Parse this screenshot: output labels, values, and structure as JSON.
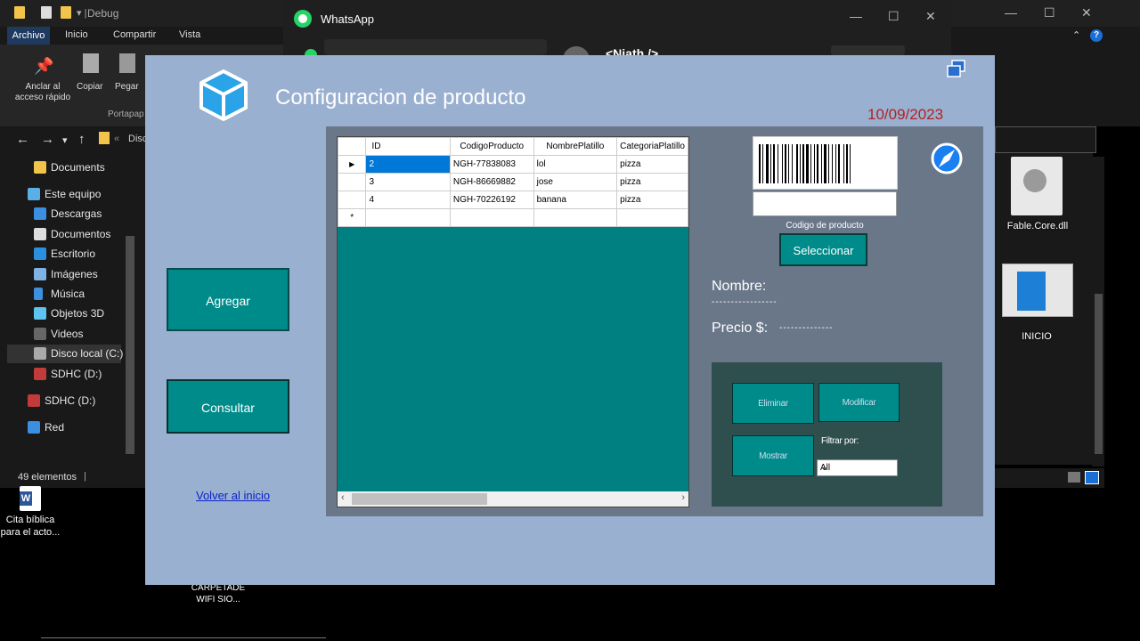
{
  "explorer": {
    "title": "Debug",
    "tabs": [
      "Archivo",
      "Inicio",
      "Compartir",
      "Vista"
    ],
    "ribbon": {
      "pin_label_1": "Anclar al",
      "pin_label_2": "acceso rápido",
      "copy_label": "Copiar",
      "paste_label": "Pegar",
      "group_label": "Portapap"
    },
    "address": "Disc",
    "tree": [
      "Documents",
      "Este equipo",
      "Descargas",
      "Documentos",
      "Escritorio",
      "Imágenes",
      "Música",
      "Objetos 3D",
      "Videos",
      "Disco local (C:)",
      "SDHC (D:)",
      "SDHC (D:)",
      "Red"
    ],
    "status": "49 elementos",
    "files": [
      "Fable.Core.dll",
      "INICIO"
    ]
  },
  "whatsapp": {
    "title": "WhatsApp",
    "contact": "<Niath />"
  },
  "desktop": {
    "doc_label_1": "Cita bíblica",
    "doc_label_2": "para el acto...",
    "folder_label_1": "CARPETADE",
    "folder_label_2": "WIFI SIO..."
  },
  "form": {
    "title": "Configuracion de producto",
    "date": "10/09/2023",
    "buttons": {
      "agregar": "Agregar",
      "consultar": "Consultar",
      "volver": "Volver al inicio",
      "seleccionar": "Seleccionar",
      "eliminar": "Eliminar",
      "modificar": "Modificar",
      "mostrar": "Mostrar"
    },
    "grid": {
      "columns": [
        "ID",
        "CodigoProducto",
        "NombrePlatillo",
        "CategoriaPlatillo"
      ],
      "rows": [
        [
          "2",
          "NGH-77838083",
          "lol",
          "pizza"
        ],
        [
          "3",
          "NGH-86669882",
          "jose",
          "pizza"
        ],
        [
          "4",
          "NGH-70226192",
          "banana",
          "pizza"
        ]
      ],
      "new_row_marker": "*",
      "current_row_marker": "▶"
    },
    "barcode_caption": "Codigo de producto",
    "nombre_label": "Nombre:",
    "nombre_value": "-----------------",
    "precio_label": "Precio $:",
    "precio_value": "--------------",
    "filter_label": "Filtrar por:",
    "filter_value": "All"
  }
}
